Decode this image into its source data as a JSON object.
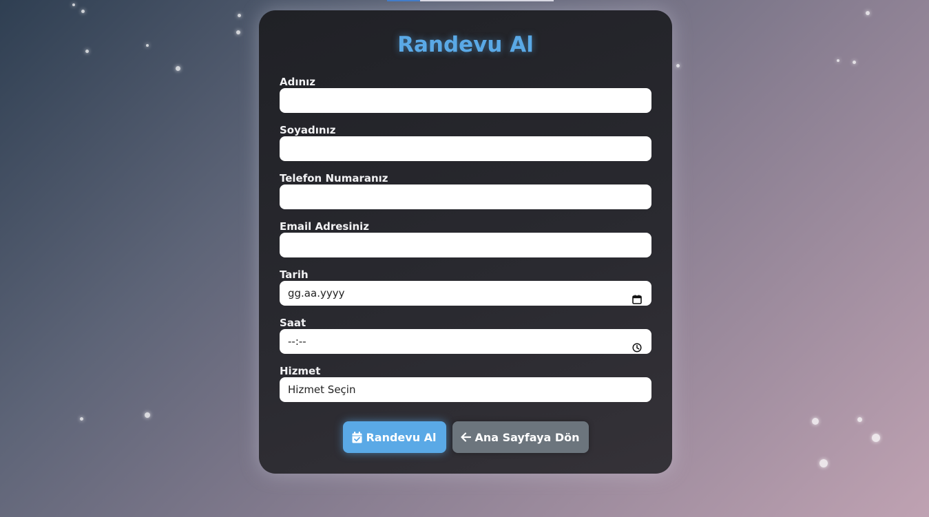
{
  "form": {
    "title": "Randevu Al",
    "fields": [
      {
        "label": "Adınız",
        "value": ""
      },
      {
        "label": "Soyadınız",
        "value": ""
      },
      {
        "label": "Telefon Numaranız",
        "value": ""
      },
      {
        "label": "Email Adresiniz",
        "value": ""
      },
      {
        "label": "Tarih",
        "value": "gg.aa.yyyy",
        "icon": "calendar-icon"
      },
      {
        "label": "Saat",
        "value": "--:--",
        "icon": "clock-icon"
      },
      {
        "label": "Hizmet",
        "value": "Hizmet Seçin"
      }
    ],
    "buttons": {
      "submit_label": "Randevu Al",
      "submit_icon": "calendar-check-icon",
      "back_label": "Ana Sayfaya Dön",
      "back_icon": "arrow-left-icon"
    }
  },
  "colors": {
    "accent": "#5aa9e6",
    "secondary": "#6c757d",
    "card_bg": "#26262b"
  }
}
